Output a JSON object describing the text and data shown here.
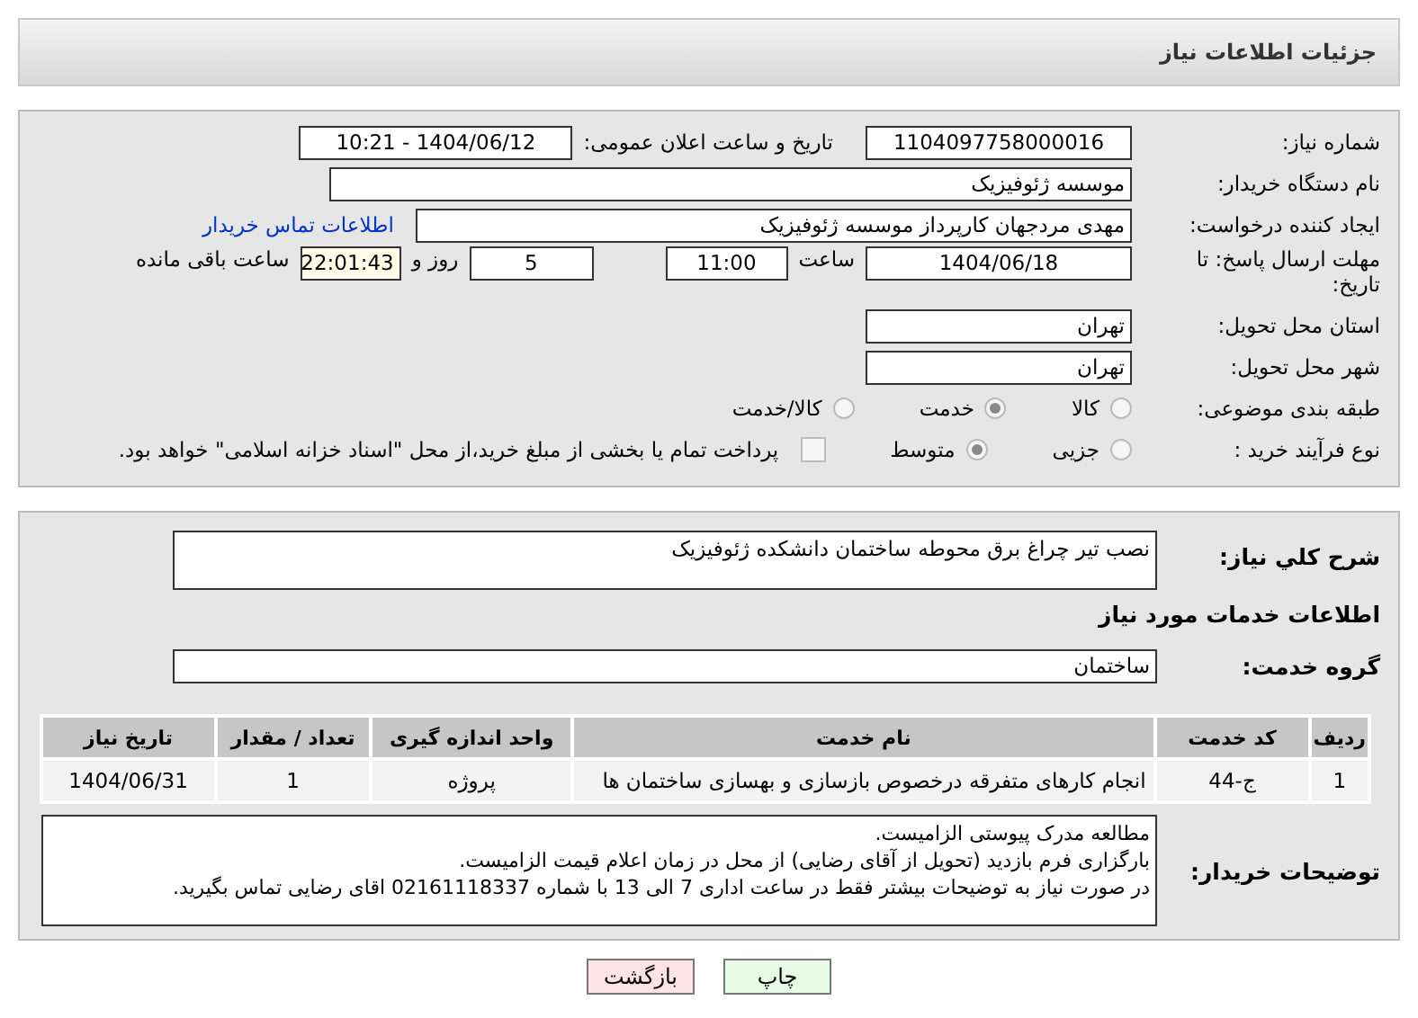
{
  "header": {
    "title": "جزئیات اطلاعات نیاز"
  },
  "need_info": {
    "need_number": {
      "label": "شماره نیاز:",
      "value": "1104097758000016"
    },
    "announce_datetime": {
      "label": "تاریخ و ساعت اعلان عمومی:",
      "value": "1404/06/12 - 10:21"
    },
    "buyer_org": {
      "label": "نام دستگاه خریدار:",
      "value": "موسسه ژئوفیزیک"
    },
    "requester": {
      "label": "ایجاد کننده درخواست:",
      "value": "مهدی مردجهان کارپرداز موسسه ژئوفیزیک",
      "link": "اطلاعات تماس خریدار"
    },
    "deadline": {
      "label": "مهلت ارسال پاسخ: تا تاریخ:",
      "date": "1404/06/18",
      "time_label": "ساعت",
      "time": "11:00",
      "days": "5",
      "days_label": "روز و",
      "remaining": "22:01:43",
      "remaining_label": "ساعت باقی مانده"
    },
    "province": {
      "label": "استان محل تحویل:",
      "value": "تهران"
    },
    "city": {
      "label": "شهر محل تحویل:",
      "value": "تهران"
    },
    "category": {
      "label": "طبقه بندی موضوعی:",
      "options": [
        {
          "label": "کالا",
          "selected": false
        },
        {
          "label": "خدمت",
          "selected": true
        },
        {
          "label": "کالا/خدمت",
          "selected": false
        }
      ]
    },
    "process": {
      "label": "نوع فرآیند خرید :",
      "options": [
        {
          "label": "جزیی",
          "selected": false
        },
        {
          "label": "متوسط",
          "selected": true
        }
      ],
      "payment": {
        "checked": false,
        "label": "پرداخت تمام یا بخشی از مبلغ خرید،از محل \"اسناد خزانه اسلامی\" خواهد بود."
      }
    }
  },
  "details": {
    "description": {
      "label": "شرح کلي نياز:",
      "value": "نصب تیر چراغ برق محوطه ساختمان دانشکده ژئوفیزیک"
    },
    "services_heading": "اطلاعات خدمات مورد نیاز",
    "service_group": {
      "label": "گروه خدمت:",
      "value": "ساختمان"
    },
    "table": {
      "columns": [
        "ردیف",
        "کد خدمت",
        "نام خدمت",
        "واحد اندازه گیری",
        "تعداد / مقدار",
        "تاریخ نیاز"
      ],
      "rows": [
        [
          "1",
          "ج-44",
          "انجام کارهای متفرقه درخصوص بازسازی و بهسازی ساختمان ها",
          "پروژه",
          "1",
          "1404/06/31"
        ]
      ]
    },
    "buyer_notes": {
      "label": "توضیحات خریدار:",
      "lines": [
        "مطالعه مدرک پیوستی الزامیست.",
        "بارگزاری فرم بازدید (تحویل از آقای رضایی) از محل در زمان اعلام قیمت الزامیست.",
        "در صورت نیاز به توضیحات بیشتر فقط در ساعت اداری 7 الی 13 با شماره 02161118337 اقای رضایی تماس بگیرید."
      ]
    }
  },
  "buttons": [
    {
      "label": "چاپ",
      "kind": "print"
    },
    {
      "label": "بازگشت",
      "kind": "back"
    }
  ]
}
